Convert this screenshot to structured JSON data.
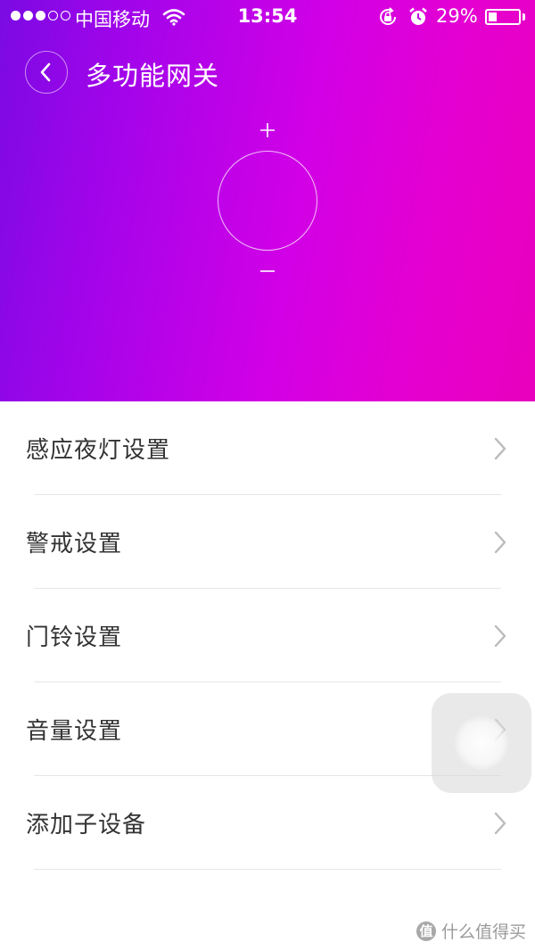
{
  "status_bar": {
    "signal_bars_filled": 3,
    "signal_bars_total": 5,
    "carrier": "中国移动",
    "wifi_icon": "wifi-icon",
    "time": "13:54",
    "rotation_lock_icon": "rotation-lock-icon",
    "alarm_icon": "alarm-icon",
    "battery_percent": "29%",
    "battery_level": 0.29
  },
  "header": {
    "back_icon": "chevron-left-icon",
    "title": "多功能网关"
  },
  "dial": {
    "plus_label": "+",
    "minus_label": "−"
  },
  "settings": {
    "items": [
      {
        "label": "感应夜灯设置"
      },
      {
        "label": "警戒设置"
      },
      {
        "label": "门铃设置"
      },
      {
        "label": "音量设置"
      },
      {
        "label": "添加子设备"
      }
    ]
  },
  "watermark": {
    "logo_text": "值",
    "text": "什么值得买"
  },
  "colors": {
    "gradient_start": "#7b0ae3",
    "gradient_mid": "#d200e6",
    "gradient_end": "#e900bd",
    "label_text": "#333333",
    "chevron": "#bbbbbb",
    "divider": "#e6e6e6"
  }
}
